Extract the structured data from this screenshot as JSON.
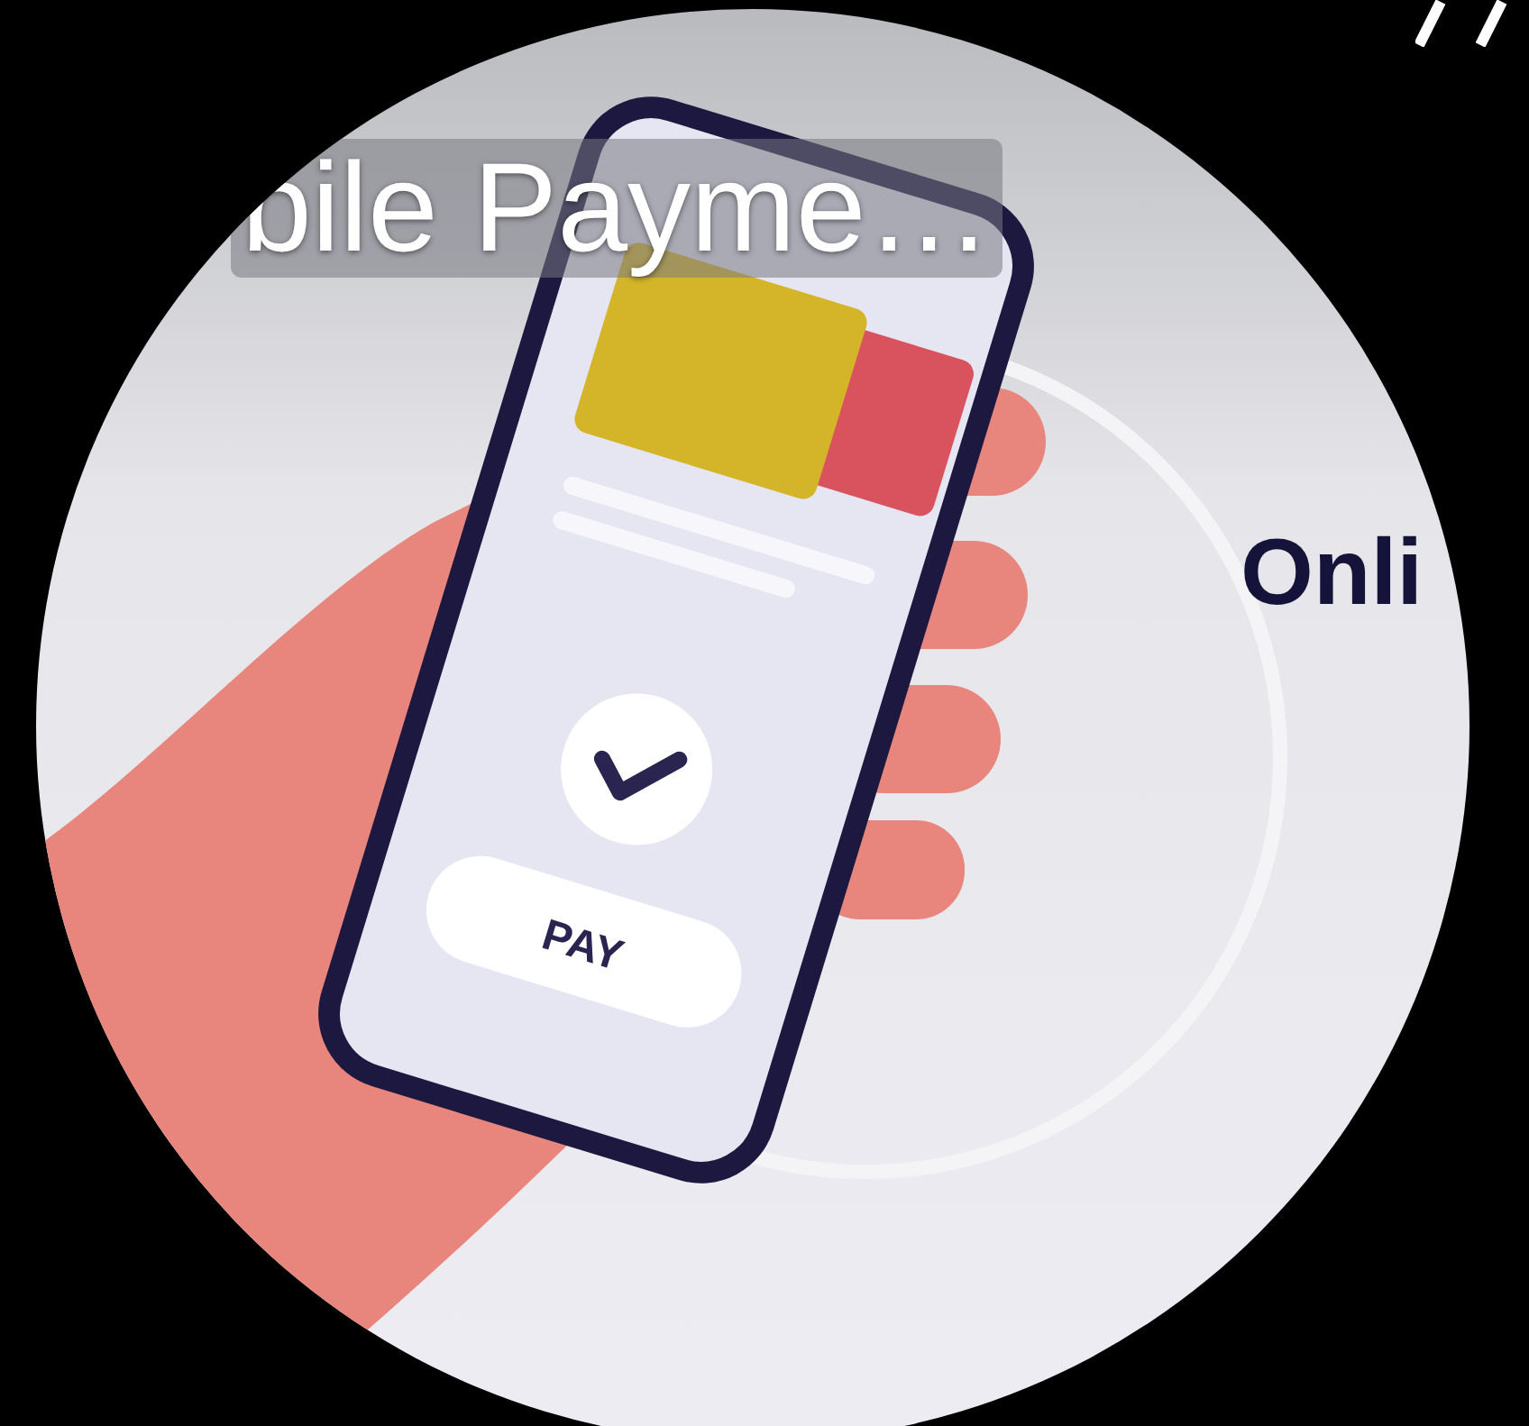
{
  "title": "bile Payme…",
  "banner": {
    "heading": "Onli"
  },
  "phone": {
    "button": "PAY"
  }
}
